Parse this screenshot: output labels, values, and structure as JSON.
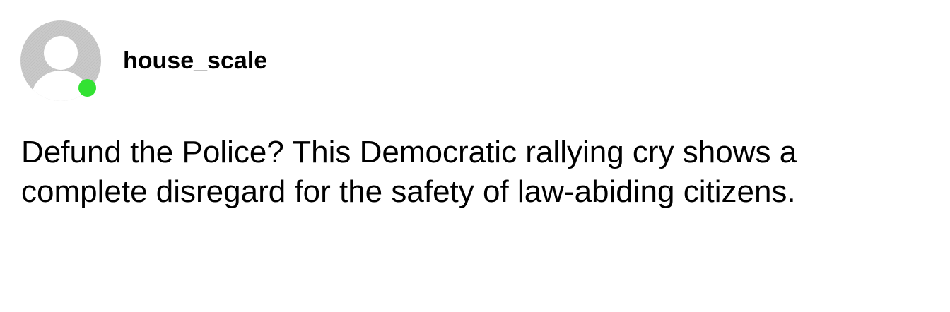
{
  "post": {
    "username": "house_scale",
    "text": "Defund the Police? This Democratic rallying cry shows a complete disregard for the safety of law-abiding citizens.",
    "avatar_icon": "default-user-avatar-icon",
    "status_icon": "online-status-icon",
    "status_color": "#33e233",
    "avatar_color": "#c8c8c8"
  }
}
